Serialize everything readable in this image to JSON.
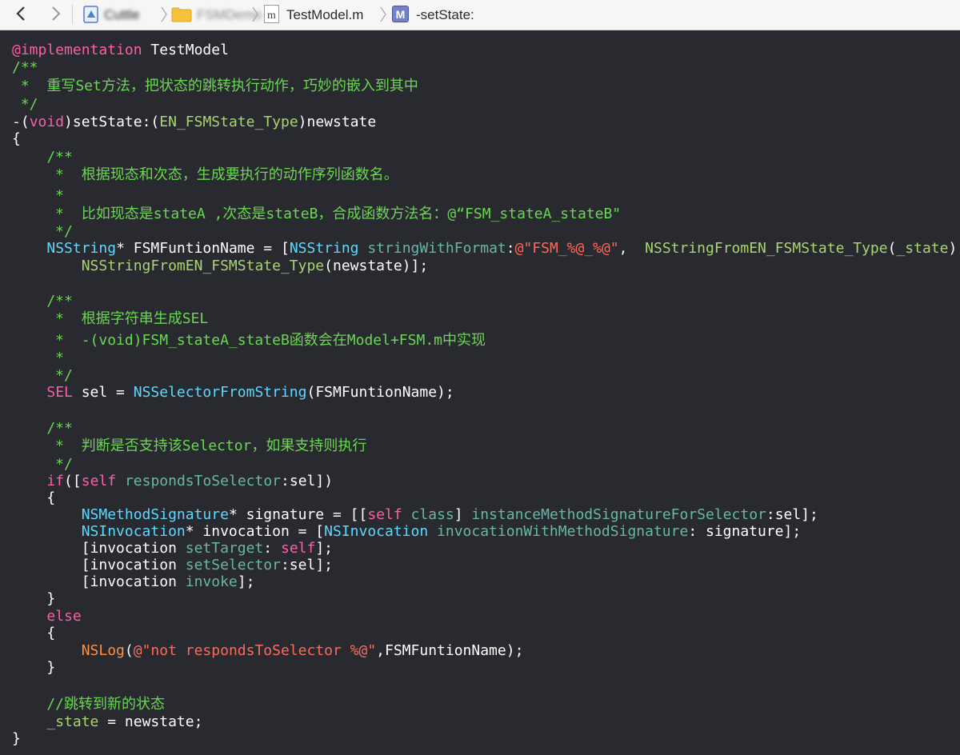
{
  "jumpbar": {
    "back_label": "‹",
    "forward_label": "›",
    "project_name": "Cuttle",
    "folder_name": "FSMDemo",
    "file_icon_letter": "m",
    "file_name": "TestModel.m",
    "method_icon_letter": "M",
    "method_name": "-setState:",
    "icons": [
      "chevron-left-icon",
      "chevron-right-icon",
      "project-icon",
      "folder-icon",
      "file-m-icon",
      "method-icon"
    ]
  },
  "colors": {
    "background": "#292a30",
    "comment": "#6bd653",
    "keyword": "#fc5fa3",
    "type": "#5dd8ff",
    "method": "#67b7a4",
    "string": "#fc6a5d",
    "function": "#a9d471",
    "plain": "#ffffff"
  },
  "code": {
    "l1": {
      "a": "@implementation",
      "b": " TestModel"
    },
    "l2": "/**",
    "l3": " *  重写Set方法，把状态的跳转执行动作，巧妙的嵌入到其中",
    "l4": " */",
    "l5": {
      "a": "-(",
      "b": "void",
      "c": ")setState:(",
      "d": "EN_FSMState_Type",
      "e": ")newstate"
    },
    "l6": "{",
    "l7": "    /**",
    "l8": "     *  根据现态和次态，生成要执行的动作序列函数名。",
    "l9": "     *",
    "l10": "     *  比如现态是stateA ,次态是stateB，合成函数方法名：@“FSM_stateA_stateB\"",
    "l11": "     */",
    "l12": {
      "a": "    ",
      "b": "NSString",
      "c": "* FSMFuntionName = [",
      "d": "NSString",
      "e": " ",
      "f": "stringWithFormat",
      "g": ":",
      "h": "@\"FSM_%@_%@\"",
      "i": ",  ",
      "j": "NSStringFromEN_FSMState_Type",
      "k": "(",
      "l": "_state",
      "m": "),",
      "n": ""
    },
    "l13": {
      "a": "        ",
      "b": "NSStringFromEN_FSMState_Type",
      "c": "(newstate)];"
    },
    "l14": "    /**",
    "l15": "     *  根据字符串生成SEL",
    "l16": "     *  -(void)FSM_stateA_stateB函数会在Model+FSM.m中实现",
    "l17": "     *",
    "l18": "     */",
    "l19": {
      "a": "    ",
      "b": "SEL",
      "c": " sel = ",
      "d": "NSSelectorFromString",
      "e": "(FSMFuntionName);"
    },
    "l20": "    /**",
    "l21": "     *  判断是否支持该Selector，如果支持则执行",
    "l22": "     */",
    "l23": {
      "a": "    ",
      "b": "if",
      "c": "([",
      "d": "self",
      "e": " ",
      "f": "respondsToSelector",
      "g": ":sel])"
    },
    "l24": "    {",
    "l25": {
      "a": "        ",
      "b": "NSMethodSignature",
      "c": "* signature = [[",
      "d": "self",
      "e": " ",
      "f": "class",
      "g": "] ",
      "h": "instanceMethodSignatureForSelector",
      "i": ":sel];"
    },
    "l26": {
      "a": "        ",
      "b": "NSInvocation",
      "c": "* invocation = [",
      "d": "NSInvocation",
      "e": " ",
      "f": "invocationWithMethodSignature",
      "g": ": signature];"
    },
    "l27": {
      "a": "        [invocation ",
      "b": "setTarget",
      "c": ": ",
      "d": "self",
      "e": "];"
    },
    "l28": {
      "a": "        [invocation ",
      "b": "setSelector",
      "c": ":sel];"
    },
    "l29": {
      "a": "        [invocation ",
      "b": "invoke",
      "c": "];"
    },
    "l30": "    }",
    "l31": {
      "a": "    ",
      "b": "else"
    },
    "l32": "    {",
    "l33": {
      "a": "        ",
      "b": "NSLog",
      "c": "(",
      "d": "@\"not respondsToSelector %@\"",
      "e": ",FSMFuntionName);"
    },
    "l34": "    }",
    "l35": "    //跳转到新的状态",
    "l36": {
      "a": "    ",
      "b": "_state",
      "c": " = newstate;"
    },
    "l37": "}"
  }
}
